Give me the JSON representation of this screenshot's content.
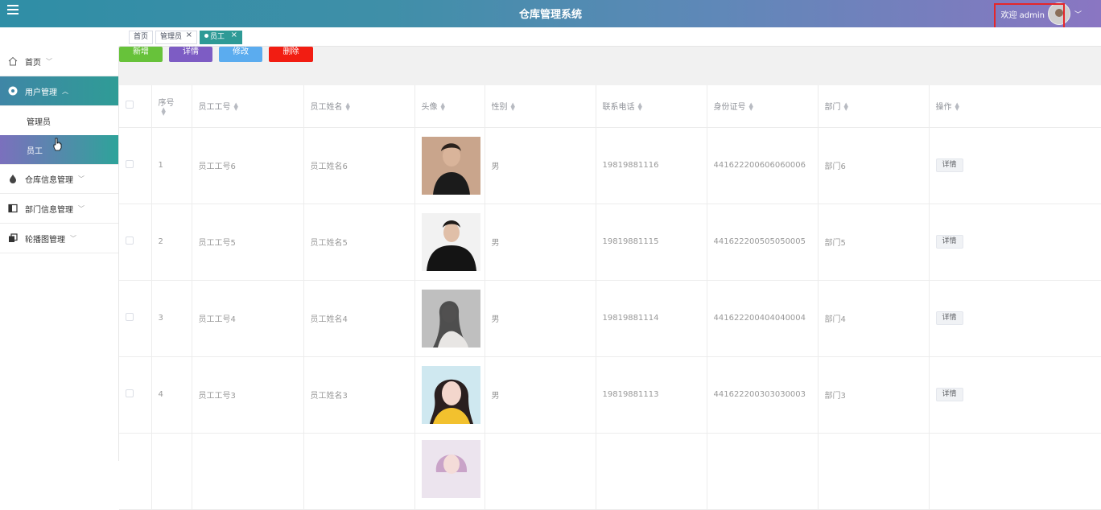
{
  "header": {
    "title": "仓库管理系统",
    "welcome": "欢迎 admin"
  },
  "tags": [
    {
      "label": "首页"
    },
    {
      "label": "管理员"
    },
    {
      "label": "员工"
    }
  ],
  "sidebar": {
    "items": [
      {
        "label": "首页"
      },
      {
        "label": "用户管理"
      },
      {
        "label": "管理员"
      },
      {
        "label": "员工"
      },
      {
        "label": "仓库信息管理"
      },
      {
        "label": "部门信息管理"
      },
      {
        "label": "轮播图管理"
      }
    ]
  },
  "toolbar": {
    "add": "新增",
    "detail": "详情",
    "edit": "修改",
    "delete": "删除"
  },
  "table": {
    "headers": [
      "序号",
      "员工工号",
      "员工姓名",
      "头像",
      "性别",
      "联系电话",
      "身份证号",
      "部门",
      "操作"
    ],
    "rows": [
      {
        "index": "1",
        "no": "员工工号6",
        "name": "员工姓名6",
        "gender": "男",
        "phone": "19819881116",
        "id_card": "441622200606060006",
        "dept": "部门6",
        "op": "详情"
      },
      {
        "index": "2",
        "no": "员工工号5",
        "name": "员工姓名5",
        "gender": "男",
        "phone": "19819881115",
        "id_card": "441622200505050005",
        "dept": "部门5",
        "op": "详情"
      },
      {
        "index": "3",
        "no": "员工工号4",
        "name": "员工姓名4",
        "gender": "男",
        "phone": "19819881114",
        "id_card": "441622200404040004",
        "dept": "部门4",
        "op": "详情"
      },
      {
        "index": "4",
        "no": "员工工号3",
        "name": "员工姓名3",
        "gender": "男",
        "phone": "19819881113",
        "id_card": "441622200303030003",
        "dept": "部门3",
        "op": "详情"
      }
    ]
  }
}
